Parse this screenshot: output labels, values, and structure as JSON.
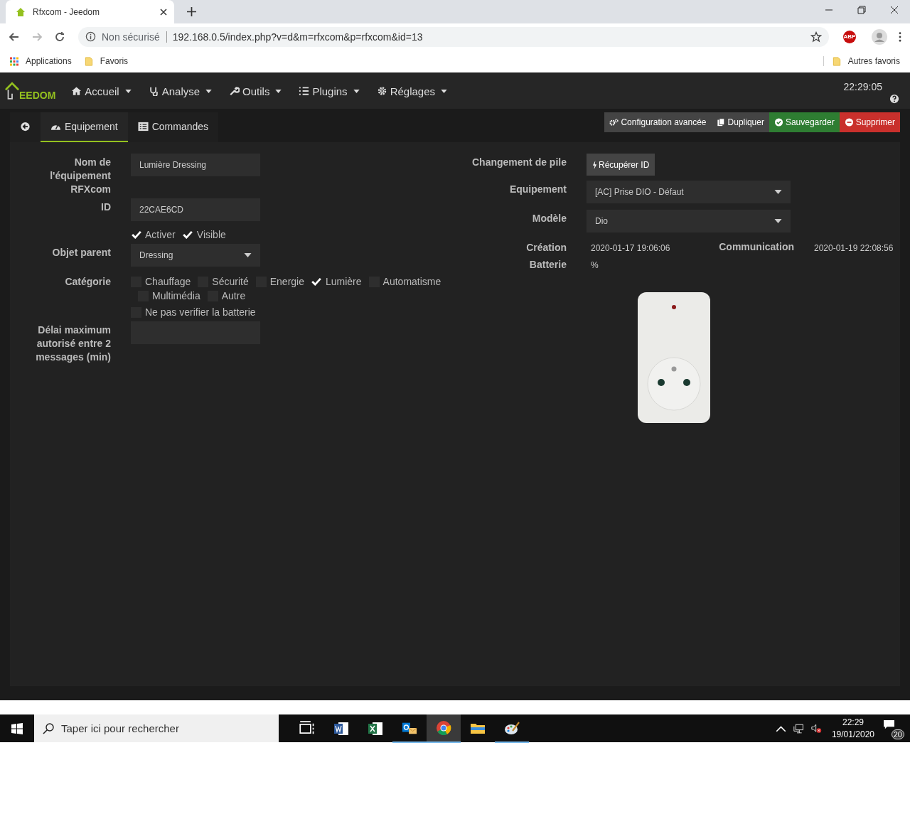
{
  "browser": {
    "tab_title": "Rfxcom - Jeedom",
    "security": "Non sécurisé",
    "url": "192.168.0.5/index.php?v=d&m=rfxcom&p=rfxcom&id=13",
    "bookmarks": [
      "Applications",
      "Favoris"
    ],
    "other_bookmarks": "Autres favoris",
    "extension_badge": "ABP"
  },
  "navbar": {
    "logo_text": "EEDOM",
    "menus": [
      {
        "label": "Accueil"
      },
      {
        "label": "Analyse"
      },
      {
        "label": "Outils"
      },
      {
        "label": "Plugins"
      },
      {
        "label": "Réglages"
      }
    ],
    "clock": "22:29:05"
  },
  "tabs": [
    {
      "label": "Equipement",
      "selected": true
    },
    {
      "label": "Commandes",
      "selected": false
    }
  ],
  "actions": [
    {
      "label": "Configuration avancée",
      "kind": "default"
    },
    {
      "label": "Dupliquer",
      "kind": "default"
    },
    {
      "label": "Sauvegarder",
      "kind": "success"
    },
    {
      "label": "Supprimer",
      "kind": "danger"
    }
  ],
  "left": {
    "name": {
      "label": "Nom de l'équipement RFXcom",
      "value": "Lumière Dressing"
    },
    "id": {
      "label": "ID",
      "value": "22CAE6CD"
    },
    "toggles": [
      {
        "label": "Activer",
        "checked": true
      },
      {
        "label": "Visible",
        "checked": true
      }
    ],
    "parent": {
      "label": "Objet parent",
      "value": "Dressing"
    },
    "category": {
      "label": "Catégorie",
      "options": [
        {
          "label": "Chauffage",
          "checked": false
        },
        {
          "label": "Sécurité",
          "checked": false
        },
        {
          "label": "Energie",
          "checked": false
        },
        {
          "label": "Lumière",
          "checked": true
        },
        {
          "label": "Automatisme",
          "checked": false
        },
        {
          "label": "Multimédia",
          "checked": false
        },
        {
          "label": "Autre",
          "checked": false
        }
      ]
    },
    "no_battery_check": {
      "label": "Ne pas verifier la batterie",
      "checked": false
    },
    "max_delay": {
      "label": "Délai maximum autorisé entre 2 messages (min)"
    }
  },
  "right": {
    "battery_change": {
      "label": "Changement de pile",
      "button": "Récupérer ID"
    },
    "equipment": {
      "label": "Equipement",
      "value": "[AC] Prise DIO - Défaut"
    },
    "model": {
      "label": "Modèle",
      "value": "Dio"
    },
    "creation": {
      "label": "Création",
      "value": "2020-01-17 19:06:06"
    },
    "communication": {
      "label": "Communication",
      "value": "2020-01-19 22:08:56"
    },
    "battery": {
      "label": "Batterie",
      "value": "%"
    }
  },
  "taskbar": {
    "search_placeholder": "Taper ici pour rechercher",
    "time": "22:29",
    "date": "19/01/2020",
    "notifications": "20"
  }
}
